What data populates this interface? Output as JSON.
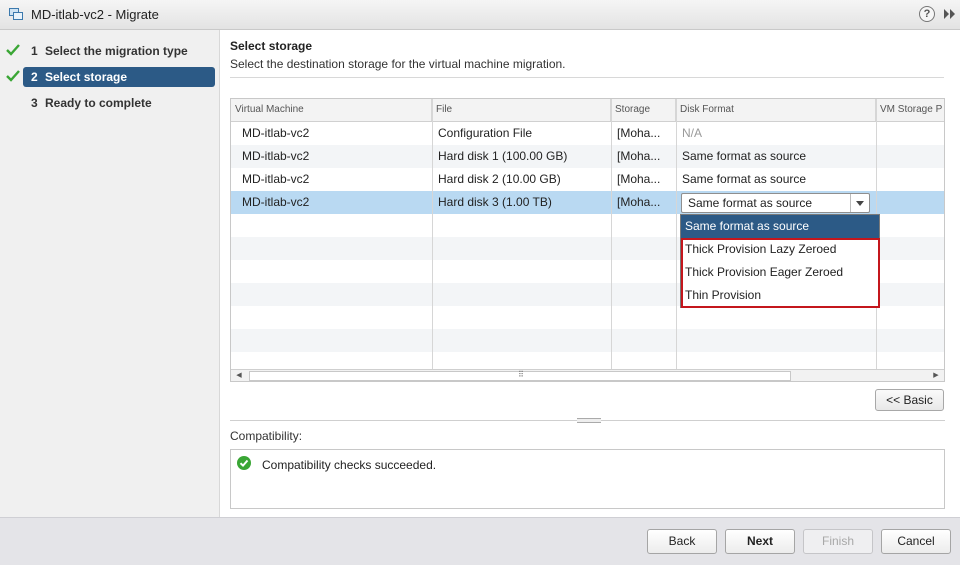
{
  "window": {
    "title": "MD-itlab-vc2 - Migrate",
    "help_label": "?"
  },
  "steps": [
    {
      "num": "1",
      "label": "Select the migration type",
      "done": true
    },
    {
      "num": "2",
      "label": "Select storage",
      "done": true,
      "active": true
    },
    {
      "num": "3",
      "label": "Ready to complete",
      "done": false
    }
  ],
  "main": {
    "title": "Select storage",
    "description": "Select the destination storage for the virtual machine migration."
  },
  "table": {
    "columns": [
      "Virtual Machine",
      "File",
      "Storage",
      "Disk Format",
      "VM Storage P"
    ],
    "rows": [
      {
        "vm": "MD-itlab-vc2",
        "file": "Configuration File",
        "storage": "[Moha...",
        "format": "N/A"
      },
      {
        "vm": "MD-itlab-vc2",
        "file": "Hard disk 1 (100.00 GB)",
        "storage": "[Moha...",
        "format": "Same format as source"
      },
      {
        "vm": "MD-itlab-vc2",
        "file": "Hard disk 2 (10.00 GB)",
        "storage": "[Moha...",
        "format": "Same format as source"
      },
      {
        "vm": "MD-itlab-vc2",
        "file": "Hard disk 3 (1.00 TB)",
        "storage": "[Moha...",
        "format": "Same format as source"
      }
    ],
    "selected_row": 3
  },
  "disk_format_dropdown": {
    "current_value": "Same format as source",
    "options": [
      "Same format as source",
      "Thick Provision Lazy Zeroed",
      "Thick Provision Eager Zeroed",
      "Thin Provision"
    ]
  },
  "basic_button": "<< Basic",
  "compatibility": {
    "label": "Compatibility:",
    "message": "Compatibility checks succeeded."
  },
  "footer": {
    "back": "Back",
    "next": "Next",
    "finish": "Finish",
    "cancel": "Cancel"
  },
  "colors": {
    "accent": "#2c5a86",
    "selected_row": "#b9d9f2",
    "highlight_border": "#c4161c",
    "success": "#3aa635"
  }
}
